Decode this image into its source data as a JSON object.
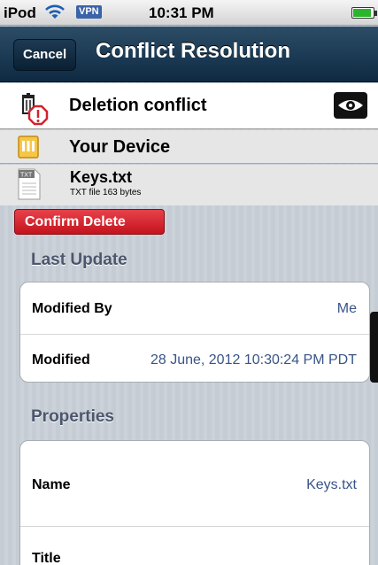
{
  "status_bar": {
    "carrier": "iPod",
    "vpn": "VPN",
    "time": "10:31 PM"
  },
  "nav": {
    "cancel_label": "Cancel",
    "title": "Conflict Resolution"
  },
  "conflict": {
    "label": "Deletion conflict"
  },
  "device": {
    "label": "Your Device"
  },
  "file": {
    "name": "Keys.txt",
    "meta": "TXT file  163 bytes",
    "icon_text": "TXT"
  },
  "actions": {
    "confirm_delete": "Confirm Delete"
  },
  "sections": {
    "last_update": {
      "title": "Last Update",
      "rows": [
        {
          "label": "Modified By",
          "value": "Me"
        },
        {
          "label": "Modified",
          "value": "28 June, 2012 10:30:24 PM PDT"
        }
      ]
    },
    "properties": {
      "title": "Properties",
      "rows": [
        {
          "label": "Name",
          "value": "Keys.txt"
        },
        {
          "label": "Title",
          "value": ""
        }
      ]
    }
  },
  "colors": {
    "nav_dark": "#0e2a42",
    "delete_red": "#d1222b",
    "value_blue": "#385487",
    "section_gray": "#4c566c"
  },
  "icons": [
    "wifi-icon",
    "battery-icon",
    "conflict-warning-icon",
    "eye-icon",
    "device-icon",
    "txt-file-icon"
  ]
}
